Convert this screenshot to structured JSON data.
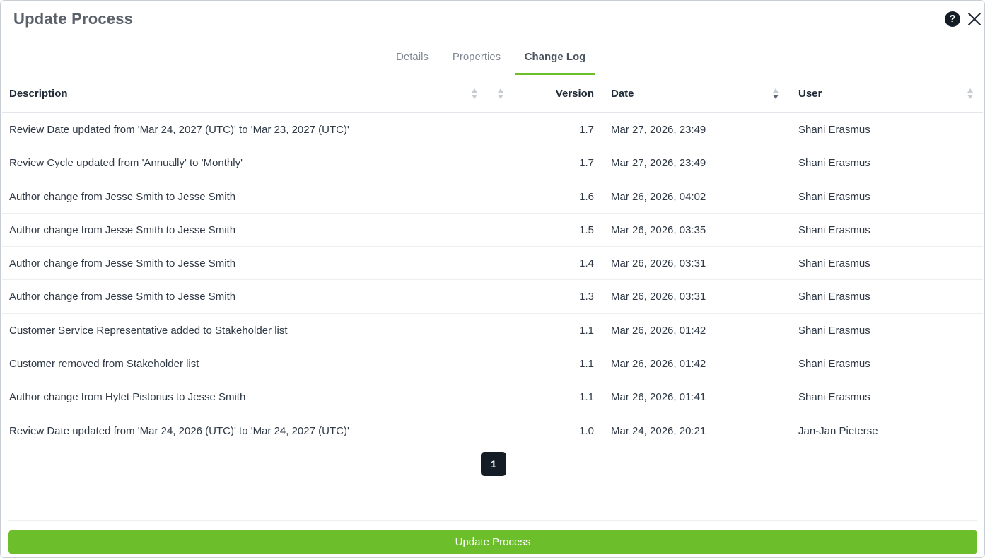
{
  "dialog": {
    "title": "Update Process",
    "help_icon": "?",
    "close_icon": "close-icon"
  },
  "tabs": [
    {
      "label": "Details",
      "active": false
    },
    {
      "label": "Properties",
      "active": false
    },
    {
      "label": "Change Log",
      "active": true
    }
  ],
  "table": {
    "columns": {
      "description": "Description",
      "version": "Version",
      "date": "Date",
      "user": "User"
    },
    "sort": {
      "column": "Date",
      "direction": "descending"
    },
    "rows": [
      {
        "description": "Review Date updated from 'Mar 24, 2027 (UTC)' to 'Mar 23, 2027 (UTC)'",
        "version": "1.7",
        "date": "Mar 27, 2026, 23:49",
        "user": "Shani Erasmus"
      },
      {
        "description": "Review Cycle updated from 'Annually' to 'Monthly'",
        "version": "1.7",
        "date": "Mar 27, 2026, 23:49",
        "user": "Shani Erasmus"
      },
      {
        "description": "Author change from Jesse Smith to Jesse Smith",
        "version": "1.6",
        "date": "Mar 26, 2026, 04:02",
        "user": "Shani Erasmus"
      },
      {
        "description": "Author change from Jesse Smith to Jesse Smith",
        "version": "1.5",
        "date": "Mar 26, 2026, 03:35",
        "user": "Shani Erasmus"
      },
      {
        "description": "Author change from Jesse Smith to Jesse Smith",
        "version": "1.4",
        "date": "Mar 26, 2026, 03:31",
        "user": "Shani Erasmus"
      },
      {
        "description": "Author change from Jesse Smith to Jesse Smith",
        "version": "1.3",
        "date": "Mar 26, 2026, 03:31",
        "user": "Shani Erasmus"
      },
      {
        "description": "Customer Service Representative added to Stakeholder list",
        "version": "1.1",
        "date": "Mar 26, 2026, 01:42",
        "user": "Shani Erasmus"
      },
      {
        "description": "Customer removed from Stakeholder list",
        "version": "1.1",
        "date": "Mar 26, 2026, 01:42",
        "user": "Shani Erasmus"
      },
      {
        "description": "Author change from Hylet Pistorius to Jesse Smith",
        "version": "1.1",
        "date": "Mar 26, 2026, 01:41",
        "user": "Shani Erasmus"
      },
      {
        "description": "Review Date updated from 'Mar 24, 2026 (UTC)' to 'Mar 24, 2027 (UTC)'",
        "version": "1.0",
        "date": "Mar 24, 2026, 20:21",
        "user": "Jan-Jan Pieterse"
      }
    ]
  },
  "pagination": {
    "current_page": "1"
  },
  "footer": {
    "submit_label": "Update Process"
  },
  "colors": {
    "accent": "#6cbf2a",
    "dark": "#141c26"
  }
}
